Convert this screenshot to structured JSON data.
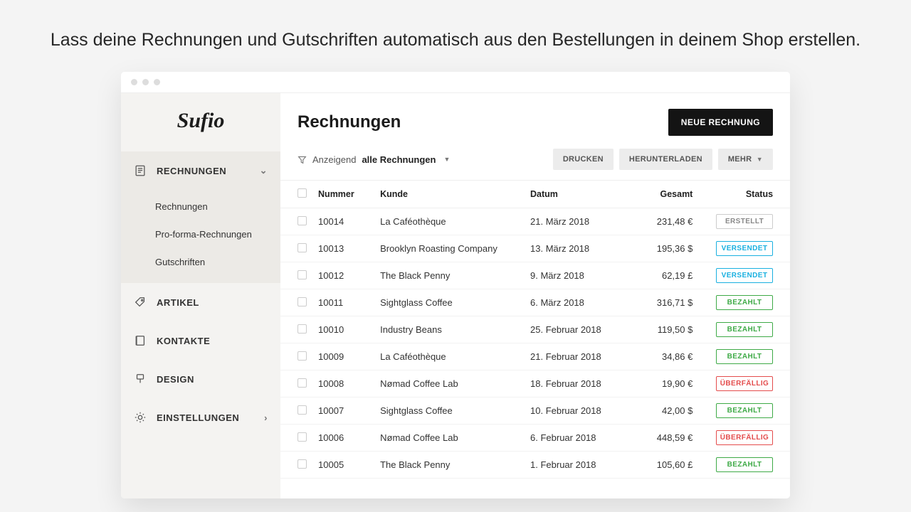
{
  "tagline": "Lass deine Rechnungen und Gutschriften automatisch aus den Bestellungen in deinem Shop erstellen.",
  "logo": "Sufio",
  "nav": {
    "invoices": "RECHNUNGEN",
    "sub": {
      "invoices": "Rechnungen",
      "proforma": "Pro-forma-Rechnungen",
      "credits": "Gutschriften"
    },
    "products": "ARTIKEL",
    "contacts": "KONTAKTE",
    "design": "DESIGN",
    "settings": "EINSTELLUNGEN"
  },
  "header": {
    "title": "Rechnungen",
    "newBtn": "NEUE RECHNUNG"
  },
  "toolbar": {
    "showing": "Anzeigend",
    "filterScope": "alle Rechnungen",
    "print": "DRUCKEN",
    "download": "HERUNTERLADEN",
    "more": "MEHR"
  },
  "columns": {
    "number": "Nummer",
    "customer": "Kunde",
    "date": "Datum",
    "total": "Gesamt",
    "status": "Status"
  },
  "statusLabels": {
    "created": "ERSTELLT",
    "sent": "VERSENDET",
    "paid": "BEZAHLT",
    "overdue": "ÜBERFÄLLIG"
  },
  "rows": [
    {
      "number": "10014",
      "customer": "La Caféothèque",
      "date": "21. März 2018",
      "total": "231,48 €",
      "status": "created"
    },
    {
      "number": "10013",
      "customer": "Brooklyn Roasting Company",
      "date": "13. März 2018",
      "total": "195,36 $",
      "status": "sent"
    },
    {
      "number": "10012",
      "customer": "The Black Penny",
      "date": "9. März 2018",
      "total": "62,19 £",
      "status": "sent"
    },
    {
      "number": "10011",
      "customer": "Sightglass Coffee",
      "date": "6. März 2018",
      "total": "316,71 $",
      "status": "paid"
    },
    {
      "number": "10010",
      "customer": "Industry Beans",
      "date": "25. Februar 2018",
      "total": "119,50 $",
      "status": "paid"
    },
    {
      "number": "10009",
      "customer": "La Caféothèque",
      "date": "21. Februar 2018",
      "total": "34,86 €",
      "status": "paid"
    },
    {
      "number": "10008",
      "customer": "Nømad Coffee Lab",
      "date": "18. Februar 2018",
      "total": "19,90 €",
      "status": "overdue"
    },
    {
      "number": "10007",
      "customer": "Sightglass Coffee",
      "date": "10. Februar 2018",
      "total": "42,00 $",
      "status": "paid"
    },
    {
      "number": "10006",
      "customer": "Nømad Coffee Lab",
      "date": "6. Februar 2018",
      "total": "448,59 €",
      "status": "overdue"
    },
    {
      "number": "10005",
      "customer": "The Black Penny",
      "date": "1. Februar 2018",
      "total": "105,60 £",
      "status": "paid"
    }
  ]
}
